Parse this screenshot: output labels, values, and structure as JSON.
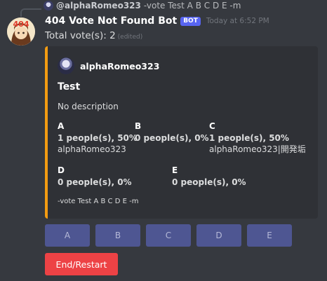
{
  "reply": {
    "username": "@alphaRomeo323",
    "text": "-vote Test A B C D E -m"
  },
  "message": {
    "bot_name": "404 Vote Not Found Bot",
    "bot_tag": "BOT",
    "timestamp": "Today at 6:52 PM",
    "content": "Total vote(s): 2",
    "edited": "(edited)"
  },
  "embed": {
    "accent_color": "#f39c12",
    "author": "alphaRomeo323",
    "title": "Test",
    "description": "No description",
    "fields": [
      {
        "name": "A",
        "count": "1 people(s), 50%",
        "voters": "alphaRomeo323"
      },
      {
        "name": "B",
        "count": "0 people(s), 0%",
        "voters": ""
      },
      {
        "name": "C",
        "count": "1 people(s), 50%",
        "voters": "alphaRomeo323|開発垢"
      },
      {
        "name": "D",
        "count": "0 people(s), 0%",
        "voters": ""
      },
      {
        "name": "E",
        "count": "0 people(s), 0%",
        "voters": ""
      }
    ],
    "footer": "-vote Test A B C D E -m"
  },
  "buttons": {
    "votes": [
      "A",
      "B",
      "C",
      "D",
      "E"
    ],
    "end_label": "End/Restart",
    "end_color": "#ed4245",
    "vote_color": "#4e5692"
  },
  "icons": {
    "bot_avatar": "404-avatar-icon",
    "reply_avatar": "user-avatar-icon",
    "author_avatar": "user-avatar-icon"
  }
}
